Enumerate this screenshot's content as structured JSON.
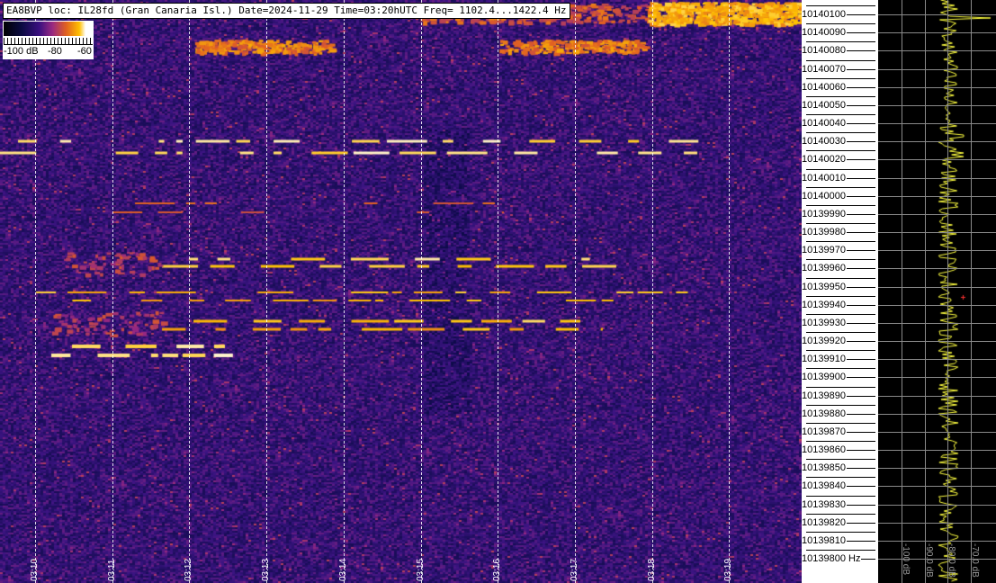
{
  "header": {
    "title": "EA8BVP loc: IL28fd (Gran Canaria Isl.) Date=2024-11-29 Time=03:20hUTC Freq= 1102.4...1422.4 Hz"
  },
  "color_scale": {
    "labels": [
      "-100 dB",
      "-80",
      "-60"
    ]
  },
  "time_axis": {
    "labels": [
      "03:10",
      "03:11",
      "03:12",
      "03:13",
      "03:14",
      "03:15",
      "03:16",
      "03:17",
      "03:18",
      "03:19"
    ]
  },
  "freq_axis": {
    "labels": [
      "10140100",
      "10140090",
      "10140080",
      "10140070",
      "10140060",
      "10140050",
      "10140040",
      "10140030",
      "10140020",
      "10140010",
      "10140000",
      "10139990",
      "10139980",
      "10139970",
      "10139960",
      "10139950",
      "10139940",
      "10139930",
      "10139920",
      "10139910",
      "10139900",
      "10139890",
      "10139880",
      "10139870",
      "10139860",
      "10139850",
      "10139840",
      "10139830",
      "10139820",
      "10139810",
      "10139800 Hz"
    ]
  },
  "power_panel": {
    "labels": [
      "-100 dB",
      "-90.0 dB",
      "-80.0 dB",
      "-70.0 dB"
    ],
    "trace_color": "#ffff40"
  }
}
